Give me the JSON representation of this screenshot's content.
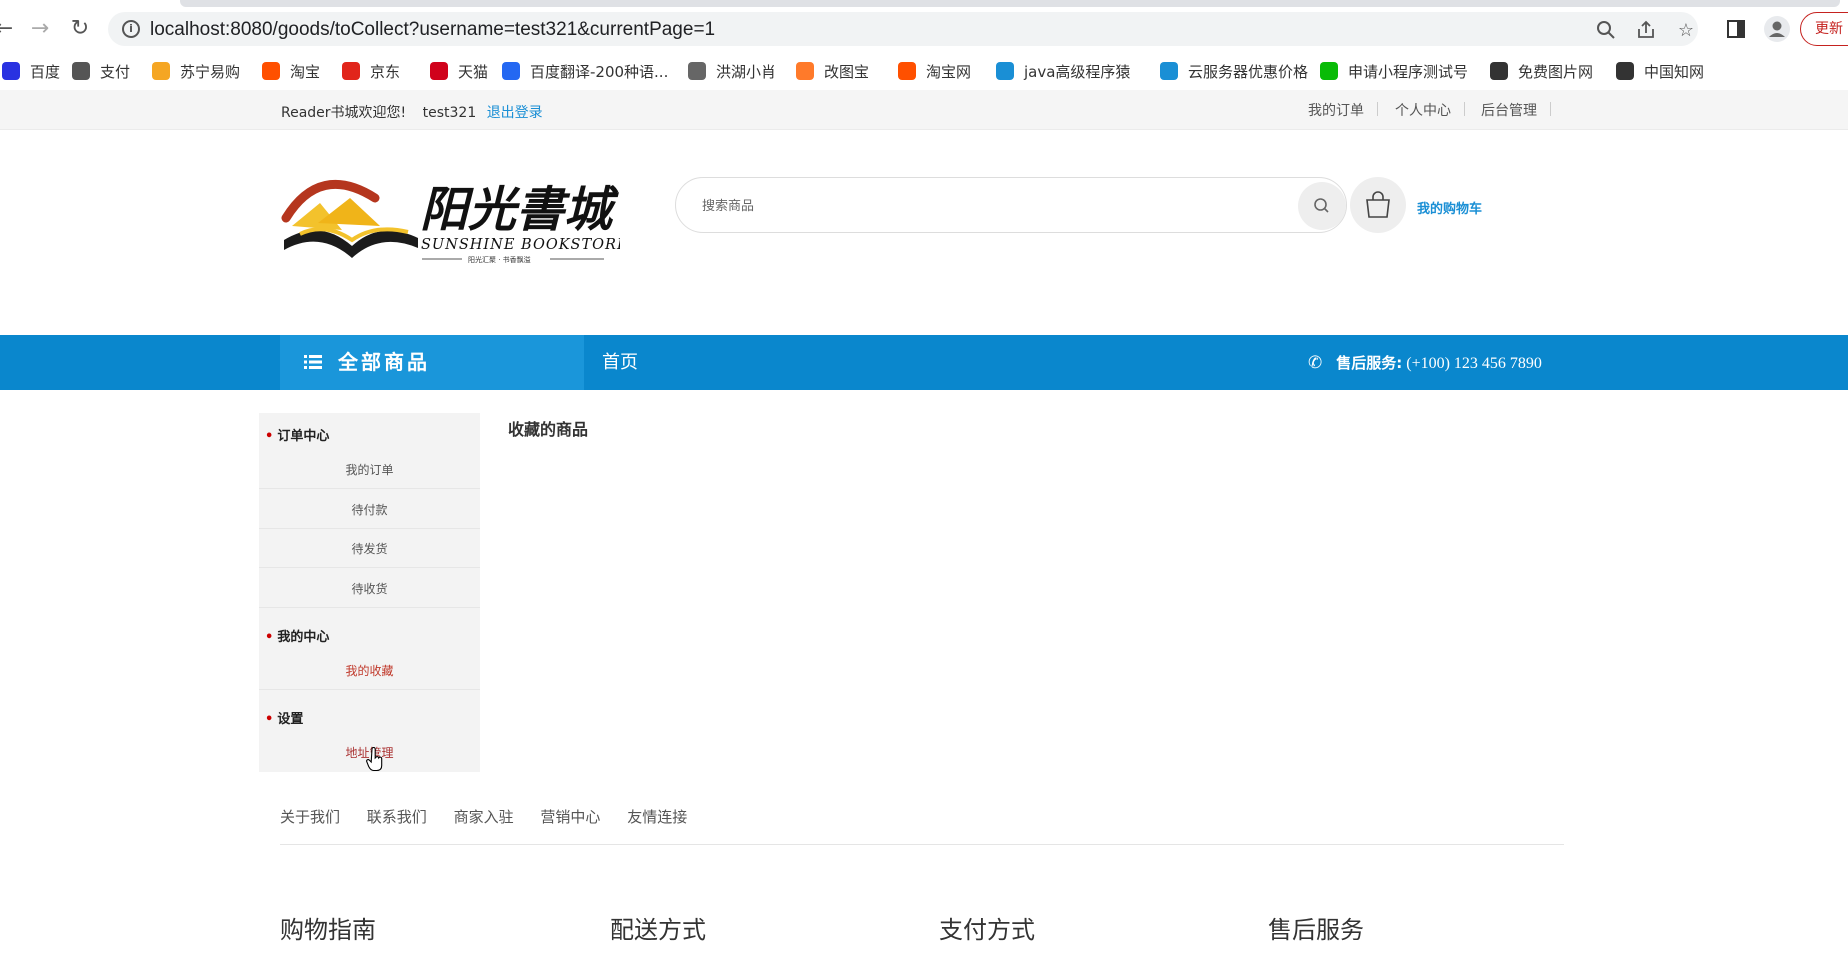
{
  "browser": {
    "url": "localhost:8080/goods/toCollect?username=test321&currentPage=1",
    "update_label": "更新",
    "bookmarks": [
      {
        "label": "百度",
        "color": "#2932e1"
      },
      {
        "label": "支付",
        "color": "#555555"
      },
      {
        "label": "苏宁易购",
        "color": "#f5a623"
      },
      {
        "label": "淘宝",
        "color": "#ff5000"
      },
      {
        "label": "京东",
        "color": "#e1251b"
      },
      {
        "label": "天猫",
        "color": "#d0021b"
      },
      {
        "label": "百度翻译-200种语...",
        "color": "#2468f2"
      },
      {
        "label": "洪湖小肖",
        "color": "#666666"
      },
      {
        "label": "改图宝",
        "color": "#ff7a2a"
      },
      {
        "label": "淘宝网",
        "color": "#ff5000"
      },
      {
        "label": "java高级程序猿",
        "color": "#1a8fd5"
      },
      {
        "label": "云服务器优惠价格",
        "color": "#1a8fd5"
      },
      {
        "label": "申请小程序测试号",
        "color": "#09bb07"
      },
      {
        "label": "免费图片网",
        "color": "#333333"
      },
      {
        "label": "中国知网",
        "color": "#333333"
      }
    ]
  },
  "topbar": {
    "welcome": "Reader书城欢迎您!",
    "username": "test321",
    "logout": "退出登录",
    "links": [
      "我的订单",
      "个人中心",
      "后台管理"
    ]
  },
  "header": {
    "logo_title": "阳光書城",
    "logo_subtitle": "SUNSHINE BOOKSTORE",
    "logo_tagline": "阳光汇聚 · 书香飘溢",
    "search_placeholder": "搜索商品",
    "cart_label": "我的购物车"
  },
  "navbar": {
    "all_goods": "全部商品",
    "home": "首页",
    "service_label": "售后服务:",
    "service_phone": "(+100) 123 456 7890"
  },
  "sidebar": {
    "sections": [
      {
        "title": "订单中心",
        "items": [
          "我的订单",
          "待付款",
          "待发货",
          "待收货"
        ]
      },
      {
        "title": "我的中心",
        "items": [
          "我的收藏"
        ]
      },
      {
        "title": "设置",
        "items": [
          "地址管理"
        ]
      }
    ]
  },
  "content": {
    "title": "收藏的商品"
  },
  "footer": {
    "links": [
      "关于我们",
      "联系我们",
      "商家入驻",
      "营销中心",
      "友情连接"
    ],
    "columns": [
      "购物指南",
      "配送方式",
      "支付方式",
      "售后服务"
    ]
  },
  "colors": {
    "brand_blue": "#0a87cd",
    "link_blue": "#1a8fd5",
    "active_red": "#c0392b"
  }
}
